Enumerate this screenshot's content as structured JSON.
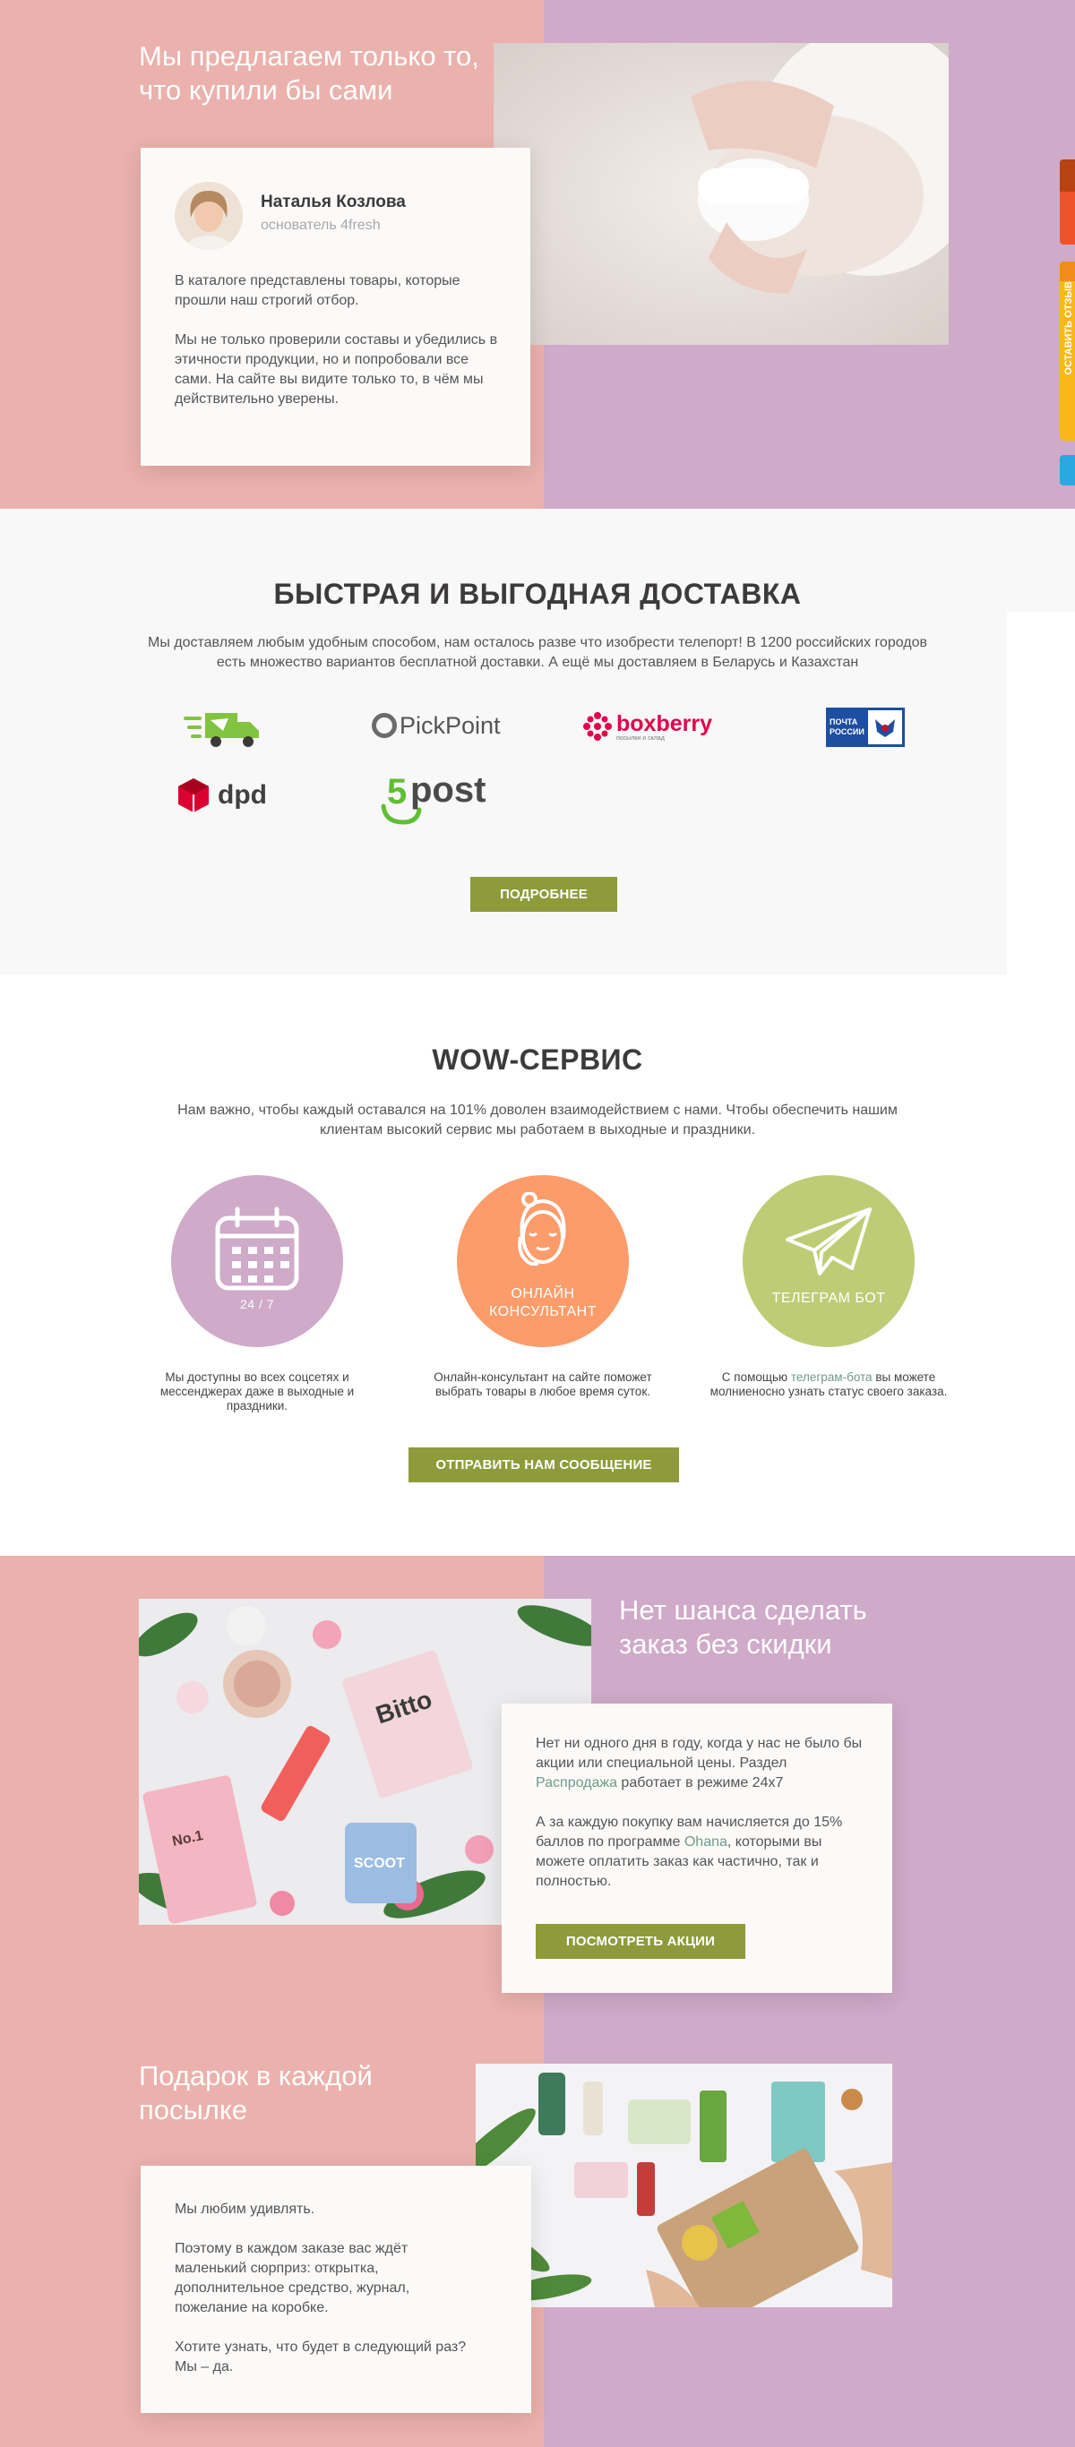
{
  "hero": {
    "title": "Мы предлагаем только то, что купили бы сами",
    "author_name": "Наталья Козлова",
    "author_role": "основатель 4fresh",
    "p1": "В каталоге представлены товары, которые прошли наш строгий отбор.",
    "p2": "Мы не только проверили составы и убедились в этичности продукции, но и попробовали все сами. На сайте вы видите только то, в чём мы действительно уверены."
  },
  "side_tabs": {
    "tab2_text": "ОСТАВИТЬ ОТЗЫВ"
  },
  "delivery": {
    "title": "БЫСТРАЯ И ВЫГОДНАЯ ДОСТАВКА",
    "lead": "Мы доставляем любым удобным способом, нам осталось разве что изобрести телепорт! В 1200 российских городов есть множество вариантов бесплатной доставки. А ещё мы доставляем в Беларусь и Казахстан",
    "logos": {
      "pickpoint": "PickPoint",
      "boxberry": "boxberry",
      "boxberry_sub": "посылки и склад",
      "pochta1": "ПОЧТА",
      "pochta2": "РОССИИ",
      "dpd": "dpd",
      "fivepost_num": "5",
      "fivepost_word": "post"
    },
    "button": "ПОДРОБНЕЕ"
  },
  "wow": {
    "title": "WOW-СЕРВИС",
    "lead": "Нам важно, чтобы каждый оставался на 101% доволен взаимодействием с нами. Чтобы обеспечить нашим клиентам высокий сервис мы работаем в выходные и праздники.",
    "items": [
      {
        "label": "24 / 7",
        "caption": "Мы доступны во всех соцсетях и мессенджерах даже в выходные и праздники."
      },
      {
        "label1": "ОНЛАЙН",
        "label2": "КОНСУЛЬТАНТ",
        "caption": "Онлайн-консультант на сайте поможет выбрать товары в любое время суток."
      },
      {
        "label": "ТЕЛЕГРАМ БОТ",
        "caption_pre": "С помощью ",
        "caption_link": "телеграм-бота",
        "caption_post": " вы можете молниеносно узнать статус своего заказа."
      }
    ],
    "button": "ОТПРАВИТЬ НАМ СООБЩЕНИЕ"
  },
  "discount": {
    "title": "Нет шанса сделать заказ без скидки",
    "p1_pre": "Нет ни одного дня в году, когда у нас не было бы акции или специальной цены. Раздел ",
    "p1_link": "Распродажа",
    "p1_post": " работает в режиме 24х7",
    "p2_pre": "А за каждую покупку вам начисляется до 15% баллов по программе ",
    "p2_link": "Ohana",
    "p2_post": ", которыми вы можете оплатить заказ как частично, так и полностью.",
    "button": "ПОСМОТРЕТЬ АКЦИИ",
    "photo_labels": [
      "Bitto",
      "SCOOT",
      "No.1"
    ]
  },
  "gift": {
    "title": "Подарок в каждой посылке",
    "p1": "Мы любим удивлять.",
    "p2": "Поэтому в каждом заказе вас ждёт маленький сюрприз: открытка, дополнительное средство, журнал, пожелание на коробке.",
    "p3": "Хотите узнать, что будет в следующий раз? Мы – да."
  },
  "colors": {
    "pink": "#ebb1ac",
    "lilac": "#cfaac9",
    "olive": "#8d9b3a",
    "orange": "#fb9c6a",
    "green": "#bfcc76"
  }
}
